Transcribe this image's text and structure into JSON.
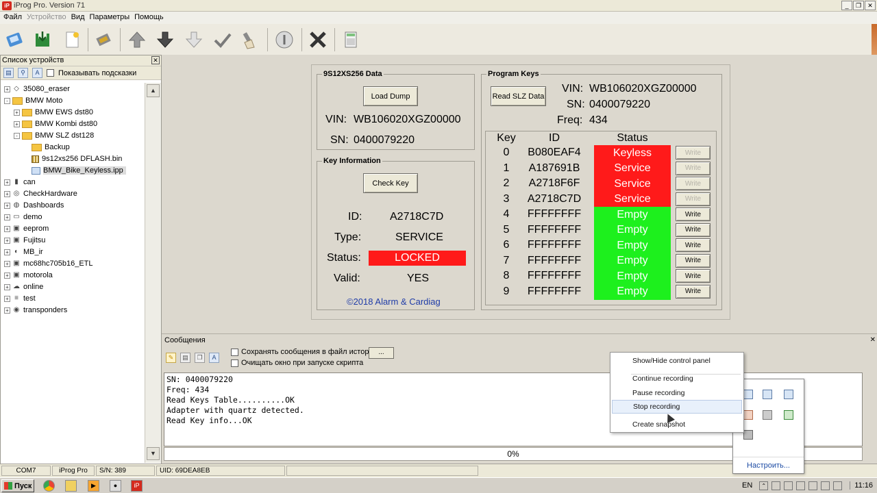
{
  "window": {
    "title": "iProg Pro. Version 71",
    "app_icon": "iP"
  },
  "menu": [
    "Файл",
    "Устройство",
    "Вид",
    "Параметры",
    "Помощь"
  ],
  "device_panel": {
    "title": "Список устройств",
    "show_hints_label": "Показывать подсказки",
    "tree": [
      {
        "label": "35080_eraser",
        "level": 0,
        "icon": "eraser-icon",
        "expander": "+"
      },
      {
        "label": "BMW Moto",
        "level": 0,
        "icon": "folder-icon",
        "expander": "-"
      },
      {
        "label": "BMW EWS dst80",
        "level": 1,
        "icon": "folder-icon",
        "expander": "+"
      },
      {
        "label": "BMW Kombi dst80",
        "level": 1,
        "icon": "folder-icon",
        "expander": "+"
      },
      {
        "label": "BMW SLZ dst128",
        "level": 1,
        "icon": "folder-icon",
        "expander": "-"
      },
      {
        "label": "Backup",
        "level": 2,
        "icon": "folder-icon",
        "expander": ""
      },
      {
        "label": "9s12xs256 DFLASH.bin",
        "level": 2,
        "icon": "binary-file-icon",
        "expander": ""
      },
      {
        "label": "BMW_Bike_Keyless.ipp",
        "level": 2,
        "icon": "project-file-icon",
        "expander": "",
        "selected": true
      },
      {
        "label": "can",
        "level": 0,
        "icon": "connector-icon",
        "expander": "+"
      },
      {
        "label": "CheckHardware",
        "level": 0,
        "icon": "gauge-icon",
        "expander": "+"
      },
      {
        "label": "Dashboards",
        "level": 0,
        "icon": "dashboard-icon",
        "expander": "+"
      },
      {
        "label": "demo",
        "level": 0,
        "icon": "folder-outline-icon",
        "expander": "+"
      },
      {
        "label": "eeprom",
        "level": 0,
        "icon": "chip-icon",
        "expander": "+"
      },
      {
        "label": "Fujitsu",
        "level": 0,
        "icon": "chip-icon",
        "expander": "+"
      },
      {
        "label": "MB_ir",
        "level": 0,
        "icon": "infrared-icon",
        "expander": "+"
      },
      {
        "label": "mc68hc705b16_ETL",
        "level": 0,
        "icon": "chip-icon",
        "expander": "+"
      },
      {
        "label": "motorola",
        "level": 0,
        "icon": "chip-icon",
        "expander": "+"
      },
      {
        "label": "online",
        "level": 0,
        "icon": "cloud-icon",
        "expander": "+"
      },
      {
        "label": "test",
        "level": 0,
        "icon": "list-icon",
        "expander": "+"
      },
      {
        "label": "transponders",
        "level": 0,
        "icon": "transponder-icon",
        "expander": "+"
      }
    ]
  },
  "dump_group": {
    "title": "9S12XS256 Data",
    "load_button": "Load Dump",
    "vin_label": "VIN:",
    "vin_value": "WB106020XGZ00000",
    "sn_label": "SN:",
    "sn_value": "0400079220"
  },
  "key_info": {
    "title": "Key Information",
    "check_button": "Check Key",
    "id_label": "ID:",
    "id_value": "A2718C7D",
    "type_label": "Type:",
    "type_value": "SERVICE",
    "status_label": "Status:",
    "status_value": "LOCKED",
    "valid_label": "Valid:",
    "valid_value": "YES",
    "copyright": "©2018 Alarm & Cardiag"
  },
  "program_keys": {
    "title": "Program Keys",
    "read_button": "Read SLZ Data",
    "vin_label": "VIN:",
    "vin_value": "WB106020XGZ00000",
    "sn_label": "SN:",
    "sn_value": "0400079220",
    "freq_label": "Freq:",
    "freq_value": "434",
    "headers": {
      "key": "Key",
      "id": "ID",
      "status": "Status"
    },
    "write_label": "Write",
    "rows": [
      {
        "key": "0",
        "id": "B080EAF4",
        "status": "Keyless",
        "color": "#ff1a1a",
        "write_enabled": false
      },
      {
        "key": "1",
        "id": "A187691B",
        "status": "Service",
        "color": "#ff1a1a",
        "write_enabled": false
      },
      {
        "key": "2",
        "id": "A2718F6F",
        "status": "Service",
        "color": "#ff1a1a",
        "write_enabled": false
      },
      {
        "key": "3",
        "id": "A2718C7D",
        "status": "Service",
        "color": "#ff1a1a",
        "write_enabled": false
      },
      {
        "key": "4",
        "id": "FFFFFFFF",
        "status": "Empty",
        "color": "#1df01d",
        "write_enabled": true
      },
      {
        "key": "5",
        "id": "FFFFFFFF",
        "status": "Empty",
        "color": "#1df01d",
        "write_enabled": true
      },
      {
        "key": "6",
        "id": "FFFFFFFF",
        "status": "Empty",
        "color": "#1df01d",
        "write_enabled": true
      },
      {
        "key": "7",
        "id": "FFFFFFFF",
        "status": "Empty",
        "color": "#1df01d",
        "write_enabled": true
      },
      {
        "key": "8",
        "id": "FFFFFFFF",
        "status": "Empty",
        "color": "#1df01d",
        "write_enabled": true
      },
      {
        "key": "9",
        "id": "FFFFFFFF",
        "status": "Empty",
        "color": "#1df01d",
        "write_enabled": true
      }
    ]
  },
  "messages": {
    "title": "Сообщения",
    "save_history_label": "Сохранять сообщения в файл истории",
    "clear_on_start_label": "Очищать окно при запуске скрипта",
    "browse_label": "...",
    "log_lines": [
      "SN: 0400079220",
      "Freq: 434",
      "Read Keys Table..........OK",
      "Adapter with quartz detected.",
      "Read Key info...OK"
    ],
    "progress": "0%"
  },
  "statusbar": [
    "COM7",
    "iProg Pro",
    "S/N: 389",
    "UID: 69DEA8EB"
  ],
  "context_menu": {
    "items": [
      {
        "label": "Show/Hide control panel"
      },
      {
        "label": "Continue recording"
      },
      {
        "label": "Pause recording"
      },
      {
        "label": "Stop recording",
        "hover": true
      },
      {
        "label": "Create snapshot"
      }
    ]
  },
  "tray_popup": {
    "customize_label": "Настроить..."
  },
  "taskbar": {
    "start_label": "Пуск",
    "lang": "EN",
    "time": "11:16"
  }
}
